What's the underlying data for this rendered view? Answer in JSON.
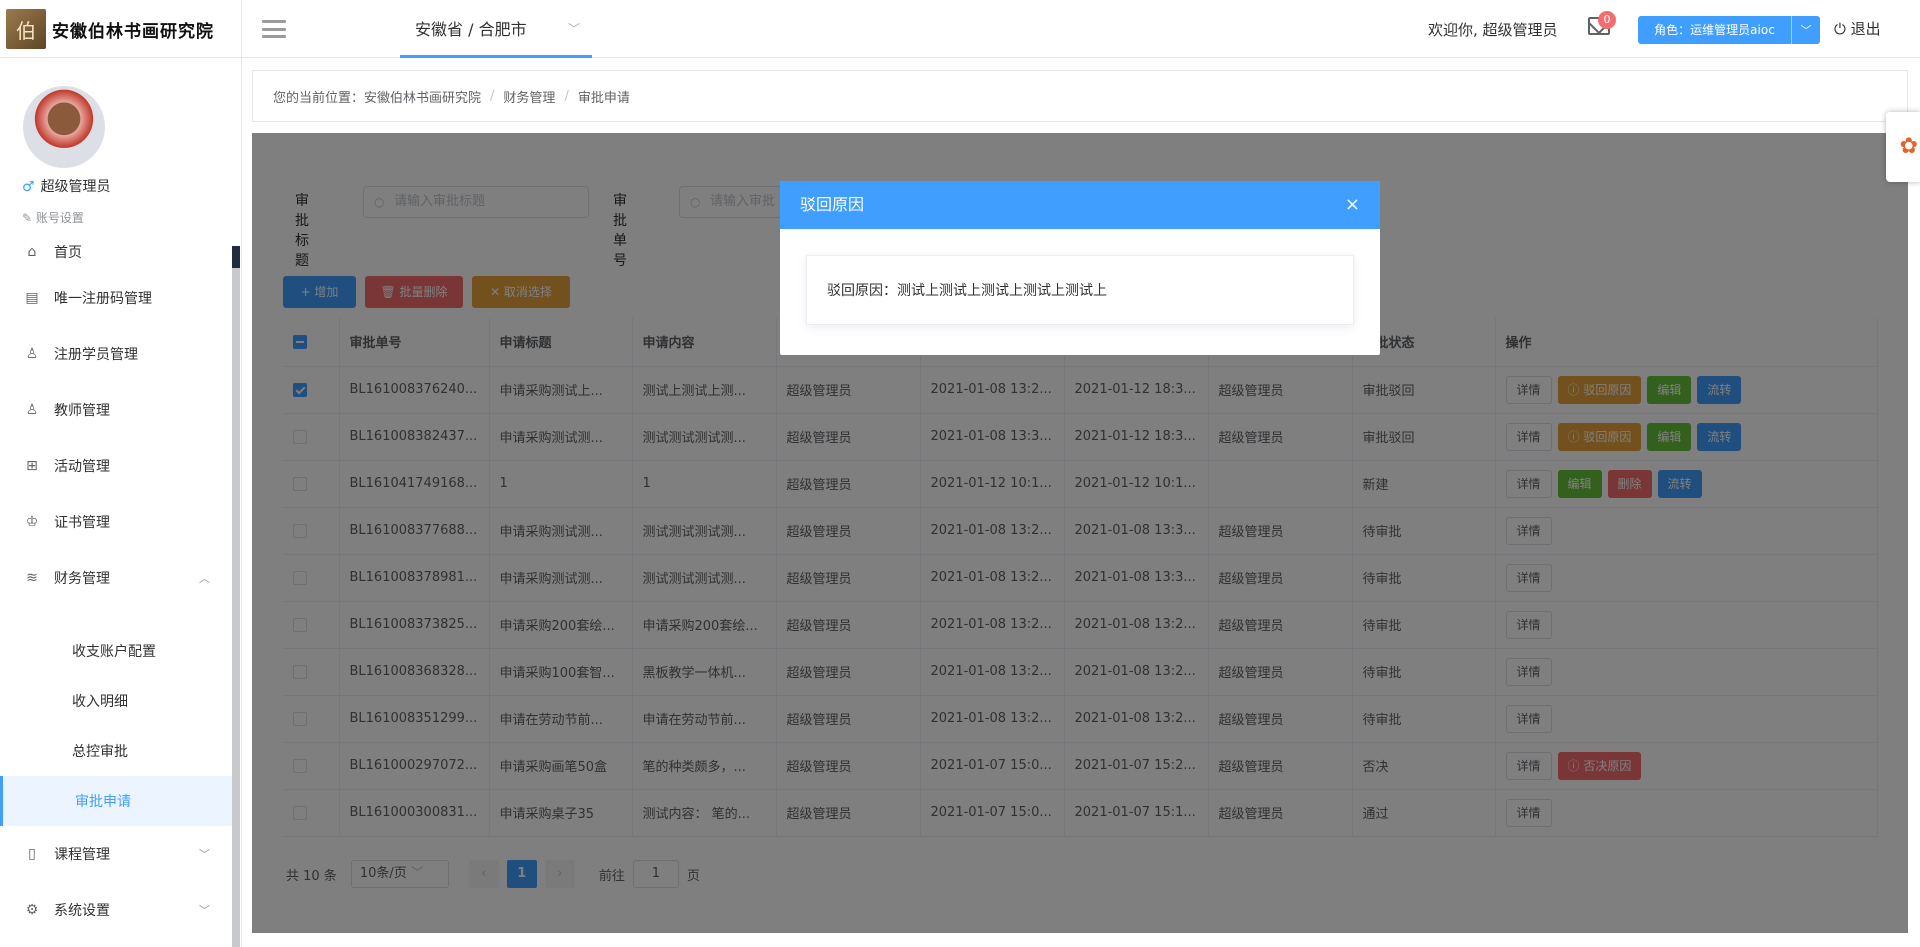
{
  "header": {
    "logo_text": "安徽伯林书画研究院",
    "logo_glyph": "伯",
    "region": "安徽省 / 合肥市",
    "welcome": "欢迎你, 超级管理员",
    "mail_count": "0",
    "role_label": "角色：运维管理员aioc",
    "logout": "退出"
  },
  "user": {
    "sex_icon": "♂",
    "name": "超级管理员",
    "account_settings": "账号设置"
  },
  "menu": [
    {
      "icon": "⌂",
      "label": "首页"
    },
    {
      "icon": "▤",
      "label": "唯一注册码管理"
    },
    {
      "icon": "♙",
      "label": "注册学员管理"
    },
    {
      "icon": "♙",
      "label": "教师管理"
    },
    {
      "icon": "⊞",
      "label": "活动管理"
    },
    {
      "icon": "♔",
      "label": "证书管理"
    },
    {
      "icon": "≋",
      "label": "财务管理",
      "arrow": "︿"
    }
  ],
  "finance_sub": [
    "收支账户配置",
    "收入明细",
    "总控审批",
    "审批申请"
  ],
  "menu_bottom": [
    {
      "icon": "▯",
      "label": "课程管理",
      "arrow": "﹀"
    },
    {
      "icon": "⚙",
      "label": "系统设置",
      "arrow": "﹀"
    }
  ],
  "breadcrumb": {
    "prefix": "您的当前位置：",
    "items": [
      "安徽伯林书画研究院",
      "财务管理",
      "审批申请"
    ],
    "sep": "/"
  },
  "search": {
    "title_label": "审批标题",
    "title_placeholder": "请输入审批标题",
    "no_label": "审批单号",
    "no_placeholder": "请输入审批"
  },
  "actions": {
    "add": "+ 增加",
    "batch_delete": "🗑 批量删除",
    "cancel_select": "✕ 取消选择"
  },
  "table": {
    "headers": [
      "",
      "审批单号",
      "申请标题",
      "申请内容",
      "",
      "",
      "",
      "",
      "审批状态",
      "操作"
    ],
    "rows": [
      {
        "checked": true,
        "no": "BL161008376240...",
        "title": "申请采购测试上...",
        "content": "测试上测试上测...",
        "applicant": "超级管理员",
        "created": "2021-01-08 13:2...",
        "updated": "2021-01-12 18:3...",
        "approver": "超级管理员",
        "status": "审批驳回",
        "status_class": "st-warn",
        "ops": [
          {
            "label": "详情",
            "cls": "detail"
          },
          {
            "label": "ⓘ 驳回原因",
            "cls": "warn"
          },
          {
            "label": "编辑",
            "cls": "green"
          },
          {
            "label": "流转",
            "cls": "blue"
          }
        ]
      },
      {
        "checked": false,
        "no": "BL161008382437...",
        "title": "申请采购测试测...",
        "content": "测试测试测试测...",
        "applicant": "超级管理员",
        "created": "2021-01-08 13:3...",
        "updated": "2021-01-12 18:3...",
        "approver": "超级管理员",
        "status": "审批驳回",
        "status_class": "st-warn",
        "ops": [
          {
            "label": "详情",
            "cls": "detail"
          },
          {
            "label": "ⓘ 驳回原因",
            "cls": "warn"
          },
          {
            "label": "编辑",
            "cls": "green"
          },
          {
            "label": "流转",
            "cls": "blue"
          }
        ]
      },
      {
        "checked": false,
        "no": "BL161041749168...",
        "title": "1",
        "content": "1",
        "applicant": "超级管理员",
        "created": "2021-01-12 10:1...",
        "updated": "2021-01-12 10:1...",
        "approver": "",
        "status": "新建",
        "status_class": "st-grey",
        "ops": [
          {
            "label": "详情",
            "cls": "detail"
          },
          {
            "label": "编辑",
            "cls": "green"
          },
          {
            "label": "删除",
            "cls": "red"
          },
          {
            "label": "流转",
            "cls": "blue"
          }
        ]
      },
      {
        "checked": false,
        "no": "BL161008377688...",
        "title": "申请采购测试测...",
        "content": "测试测试测试测...",
        "applicant": "超级管理员",
        "created": "2021-01-08 13:2...",
        "updated": "2021-01-08 13:3...",
        "approver": "超级管理员",
        "status": "待审批",
        "status_class": "st-grey",
        "ops": [
          {
            "label": "详情",
            "cls": "detail"
          }
        ]
      },
      {
        "checked": false,
        "no": "BL161008378981...",
        "title": "申请采购测试测...",
        "content": "测试测试测试测...",
        "applicant": "超级管理员",
        "created": "2021-01-08 13:2...",
        "updated": "2021-01-08 13:3...",
        "approver": "超级管理员",
        "status": "待审批",
        "status_class": "st-grey",
        "ops": [
          {
            "label": "详情",
            "cls": "detail"
          }
        ]
      },
      {
        "checked": false,
        "no": "BL161008373825...",
        "title": "申请采购200套绘...",
        "content": "申请采购200套绘...",
        "applicant": "超级管理员",
        "created": "2021-01-08 13:2...",
        "updated": "2021-01-08 13:2...",
        "approver": "超级管理员",
        "status": "待审批",
        "status_class": "st-grey",
        "ops": [
          {
            "label": "详情",
            "cls": "detail"
          }
        ]
      },
      {
        "checked": false,
        "no": "BL161008368328...",
        "title": "申请采购100套智...",
        "content": "黑板教学一体机...",
        "applicant": "超级管理员",
        "created": "2021-01-08 13:2...",
        "updated": "2021-01-08 13:2...",
        "approver": "超级管理员",
        "status": "待审批",
        "status_class": "st-grey",
        "ops": [
          {
            "label": "详情",
            "cls": "detail"
          }
        ]
      },
      {
        "checked": false,
        "no": "BL161008351299...",
        "title": "申请在劳动节前...",
        "content": "申请在劳动节前...",
        "applicant": "超级管理员",
        "created": "2021-01-08 13:2...",
        "updated": "2021-01-08 13:2...",
        "approver": "超级管理员",
        "status": "待审批",
        "status_class": "st-grey",
        "ops": [
          {
            "label": "详情",
            "cls": "detail"
          }
        ]
      },
      {
        "checked": false,
        "no": "BL161000297072...",
        "title": "申请采购画笔50盒",
        "content": "笔的种类颇多，...",
        "applicant": "超级管理员",
        "created": "2021-01-07 15:0...",
        "updated": "2021-01-07 15:2...",
        "approver": "超级管理员",
        "status": "否决",
        "status_class": "st-red",
        "ops": [
          {
            "label": "详情",
            "cls": "detail"
          },
          {
            "label": "ⓘ 否决原因",
            "cls": "red"
          }
        ]
      },
      {
        "checked": false,
        "no": "BL161000300831...",
        "title": "申请采购桌子35",
        "content": "测试内容： 笔的...",
        "applicant": "超级管理员",
        "created": "2021-01-07 15:0...",
        "updated": "2021-01-07 15:1...",
        "approver": "超级管理员",
        "status": "通过",
        "status_class": "st-ok",
        "ops": [
          {
            "label": "详情",
            "cls": "detail"
          }
        ]
      }
    ]
  },
  "pagination": {
    "total": "共 10 条",
    "page_size": "10条/页",
    "prev": "‹",
    "current": "1",
    "next": "›",
    "goto_label": "前往",
    "goto_value": "1",
    "page_suffix": "页"
  },
  "dialog": {
    "title": "驳回原因",
    "close": "×",
    "body": "驳回原因：测试上测试上测试上测试上测试上"
  },
  "settings_icon": "✿"
}
